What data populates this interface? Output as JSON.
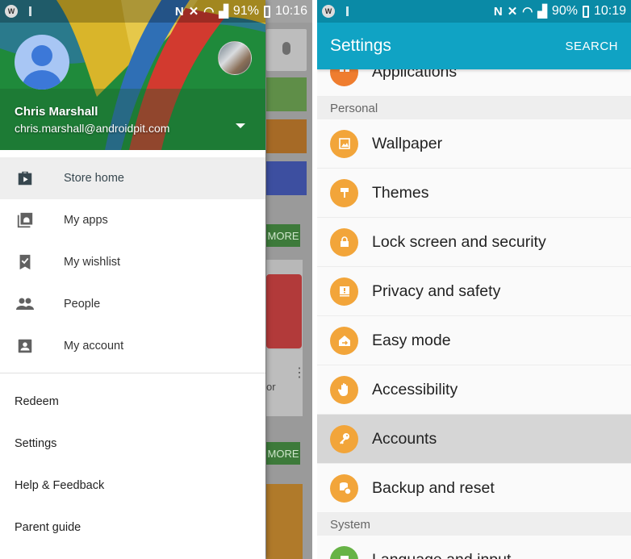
{
  "left": {
    "status": {
      "battery": "91%",
      "time": "10:16",
      "app_badge": "W"
    },
    "user": {
      "name": "Chris Marshall",
      "email": "chris.marshall@androidpit.com"
    },
    "nav_items": [
      {
        "label": "Store home",
        "icon": "shopping-bag-icon",
        "active": true
      },
      {
        "label": "My apps",
        "icon": "android-apps-icon"
      },
      {
        "label": "My wishlist",
        "icon": "bookmark-check-icon"
      },
      {
        "label": "People",
        "icon": "people-icon"
      },
      {
        "label": "My account",
        "icon": "account-box-icon"
      }
    ],
    "links": [
      "Redeem",
      "Settings",
      "Help & Feedback",
      "Parent guide"
    ],
    "background": {
      "more_label": "MORE",
      "partial_text": "or"
    }
  },
  "right": {
    "status": {
      "battery": "90%",
      "time": "10:19",
      "app_badge": "W"
    },
    "appbar": {
      "title": "Settings",
      "search": "SEARCH"
    },
    "partial_top_item": "Applications",
    "sections": [
      {
        "header": "Personal",
        "items": [
          {
            "label": "Wallpaper",
            "icon": "wallpaper-icon"
          },
          {
            "label": "Themes",
            "icon": "paint-roller-icon"
          },
          {
            "label": "Lock screen and security",
            "icon": "lock-icon"
          },
          {
            "label": "Privacy and safety",
            "icon": "warning-icon"
          },
          {
            "label": "Easy mode",
            "icon": "easy-mode-home-icon"
          },
          {
            "label": "Accessibility",
            "icon": "hand-icon"
          },
          {
            "label": "Accounts",
            "icon": "key-icon",
            "selected": true
          },
          {
            "label": "Backup and reset",
            "icon": "backup-icon"
          }
        ]
      },
      {
        "header": "System",
        "items": [
          {
            "label": "Language and input",
            "icon": "language-icon"
          }
        ]
      }
    ],
    "colors": {
      "appbar": "#10a3c4",
      "statusbar": "#0a8aa6",
      "icon_circle": "#f2a53a",
      "applications_circle": "#ef7d2f"
    }
  }
}
